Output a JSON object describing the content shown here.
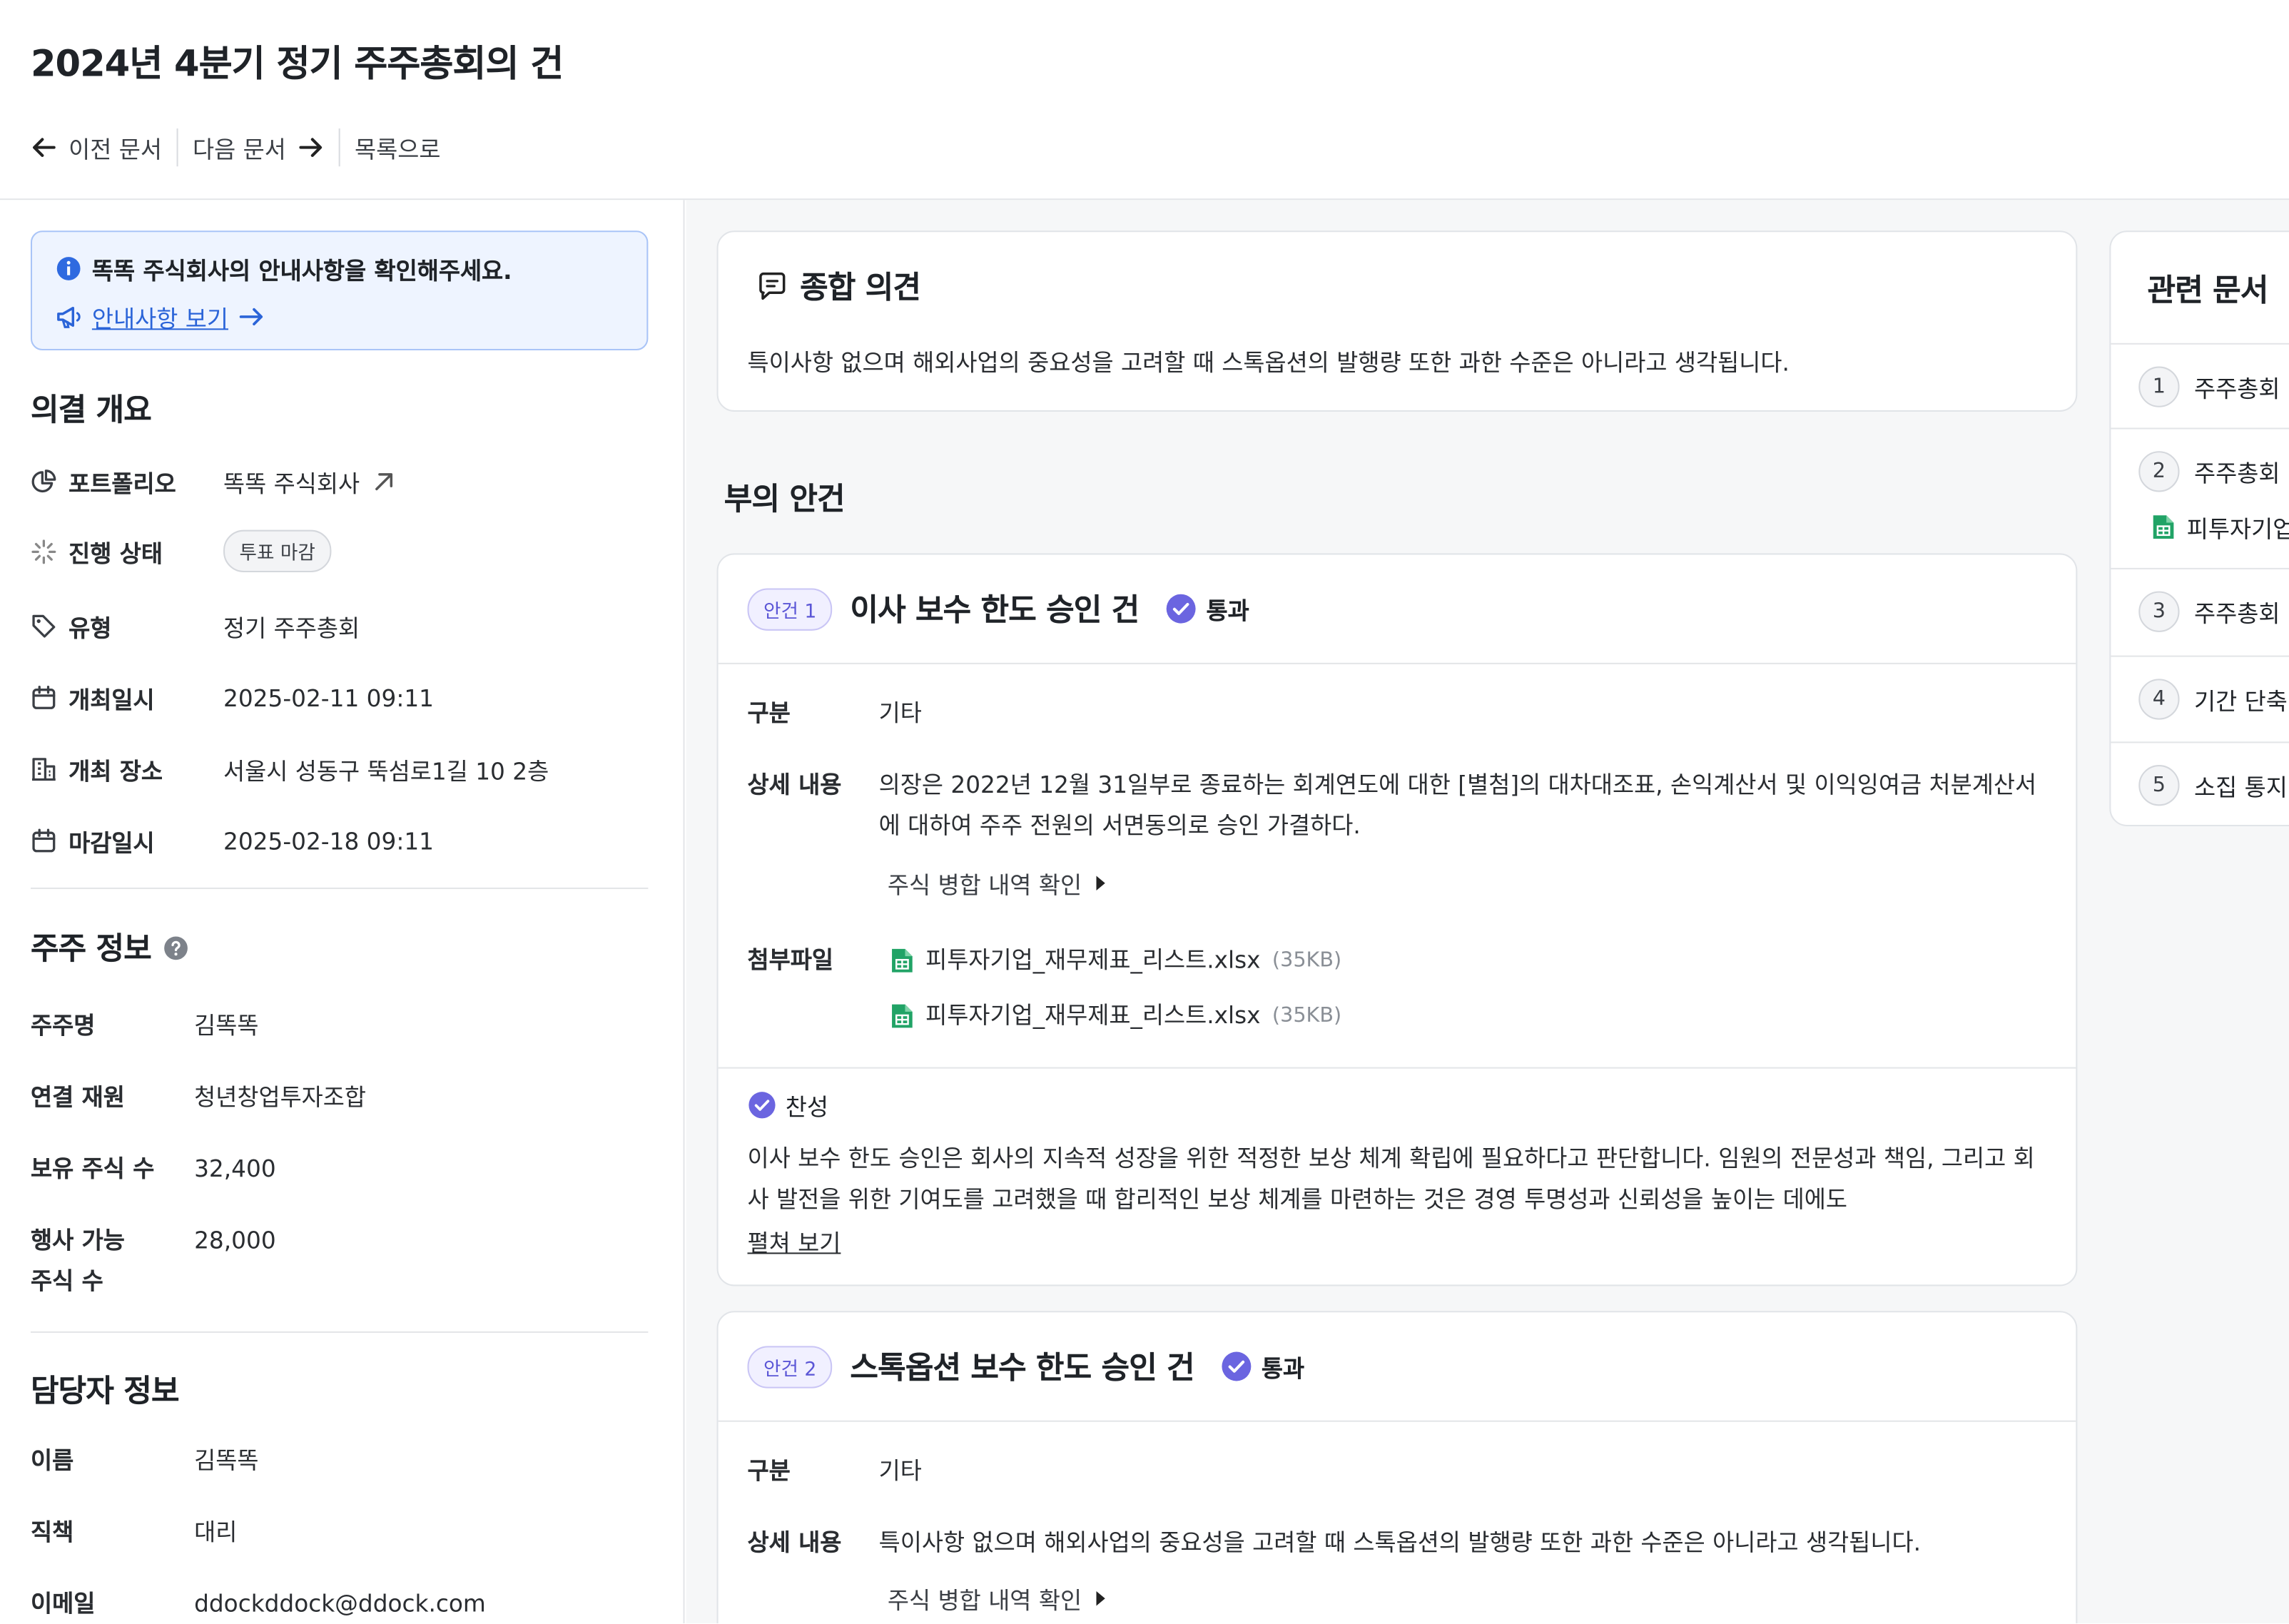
{
  "header": {
    "title": "2024년 4분기 정기 주주총회의 건",
    "nav": {
      "prev": "이전 문서",
      "next": "다음 문서",
      "list": "목록으로"
    }
  },
  "notice": {
    "text": "똑똑 주식회사의 안내사항을 확인해주세요.",
    "link": "안내사항 보기"
  },
  "overview": {
    "title": "의결 개요",
    "rows": [
      {
        "label": "포트폴리오",
        "value": "똑똑 주식회사"
      },
      {
        "label": "진행 상태",
        "value": "투표 마감"
      },
      {
        "label": "유형",
        "value": "정기 주주총회"
      },
      {
        "label": "개최일시",
        "value": "2025-02-11 09:11"
      },
      {
        "label": "개최 장소",
        "value": "서울시 성동구 뚝섬로1길 10 2층"
      },
      {
        "label": "마감일시",
        "value": "2025-02-18 09:11"
      }
    ]
  },
  "shareholder": {
    "title": "주주 정보",
    "rows": [
      {
        "label": "주주명",
        "value": "김똑똑"
      },
      {
        "label": "연결 재원",
        "value": "청년창업투자조합"
      },
      {
        "label": "보유 주식 수",
        "value": "32,400"
      },
      {
        "label": "행사 가능 주식 수",
        "value": "28,000"
      }
    ]
  },
  "manager": {
    "title": "담당자 정보",
    "rows": [
      {
        "label": "이름",
        "value": "김똑똑"
      },
      {
        "label": "직책",
        "value": "대리"
      },
      {
        "label": "이메일",
        "value": "ddockddock@ddock.com"
      }
    ]
  },
  "opinion": {
    "title": "종합 의견",
    "text": "특이사항 없으며 해외사업의 중요성을 고려할 때 스톡옵션의 발행량 또한 과한 수준은 아니라고 생각됩니다."
  },
  "agenda_section": "부의 안건",
  "agendas": [
    {
      "chip": "안건 1",
      "title": "이사 보수 한도 승인 건",
      "result": "통과",
      "category_label": "구분",
      "category": "기타",
      "detail_label": "상세 내용",
      "detail": "의장은 2022년 12월 31일부로 종료하는 회계연도에 대한 [별첨]의 대차대조표, 손익계산서 및 이익잉여금 처분계산서에 대하여 주주 전원의 서면동의로 승인 가결하다.",
      "merge": "주식 병합 내역 확인",
      "files_label": "첨부파일",
      "files": [
        {
          "name": "피투자기업_재무제표_리스트.xlsx",
          "size": "(35KB)"
        },
        {
          "name": "피투자기업_재무제표_리스트.xlsx",
          "size": "(35KB)"
        }
      ],
      "vote": "찬성",
      "vote_text": "이사 보수 한도 승인은 회사의 지속적 성장을 위한 적정한 보상 체계 확립에 필요하다고 판단합니다. 임원의 전문성과 책임, 그리고 회사 발전을 위한 기여도를 고려했을 때 합리적인 보상 체계를 마련하는 것은 경영 투명성과 신뢰성을 높이는 데에도",
      "expand": "펼쳐 보기"
    },
    {
      "chip": "안건 2",
      "title": "스톡옵션 보수 한도 승인 건",
      "result": "통과",
      "category_label": "구분",
      "category": "기타",
      "detail_label": "상세 내용",
      "detail": "특이사항 없으며 해외사업의 중요성을 고려할 때 스톡옵션의 발행량 또한 과한 수준은 아니라고 생각됩니다.",
      "merge": "주식 병합 내역 확인"
    }
  ],
  "related": {
    "title": "관련 문서",
    "items": [
      {
        "num": "1",
        "text": "주주총회"
      },
      {
        "num": "2",
        "text": "주주총회",
        "file": "피투자기업"
      },
      {
        "num": "3",
        "text": "주주총회"
      },
      {
        "num": "4",
        "text": "기간 단축"
      },
      {
        "num": "5",
        "text": "소집 통지"
      }
    ]
  }
}
